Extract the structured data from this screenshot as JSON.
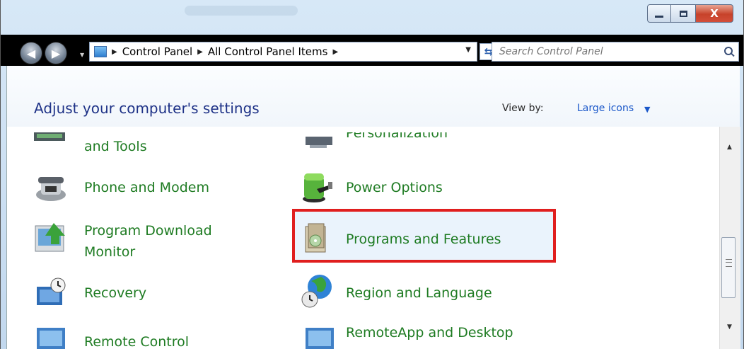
{
  "window": {
    "minimize_symbol": "–",
    "maximize_symbol": "□",
    "close_symbol": "X"
  },
  "navigation": {
    "address_path": [
      "Control Panel",
      "All Control Panel Items"
    ],
    "search_placeholder": "Search Control Panel"
  },
  "header": {
    "title": "Adjust your computer's settings",
    "view_by_label": "View by:",
    "view_by_value": "Large icons"
  },
  "items": {
    "left": [
      {
        "label": "and Tools",
        "icon": "tools-icon"
      },
      {
        "label": "Phone and Modem",
        "icon": "phone-icon"
      },
      {
        "label": "Program Download",
        "label2": "Monitor",
        "icon": "download-monitor-icon"
      },
      {
        "label": "Recovery",
        "icon": "recovery-icon"
      },
      {
        "label": "Remote Control",
        "icon": "remote-control-icon"
      }
    ],
    "right": [
      {
        "label": "Personalization",
        "icon": "personalization-icon"
      },
      {
        "label": "Power Options",
        "icon": "power-options-icon"
      },
      {
        "label": "Programs and Features",
        "icon": "programs-features-icon",
        "highlighted": true
      },
      {
        "label": "Region and Language",
        "icon": "region-language-icon"
      },
      {
        "label": "RemoteApp and Desktop",
        "icon": "remoteapp-icon"
      }
    ]
  },
  "colors": {
    "link_green": "#1e7b22",
    "heading_blue": "#1e3287",
    "highlight_red": "#e01e1e"
  }
}
